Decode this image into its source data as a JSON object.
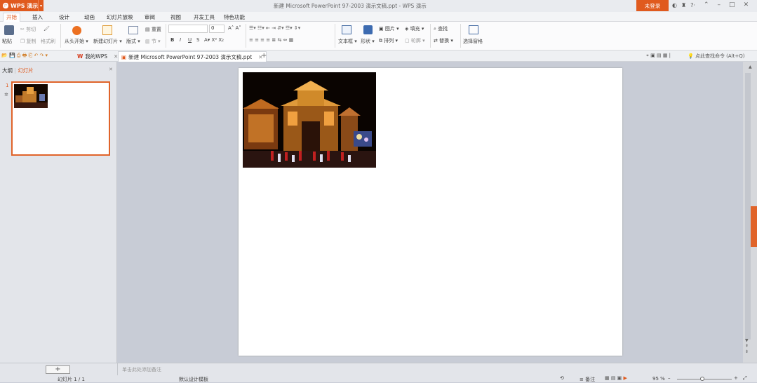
{
  "app": {
    "name": "WPS 演示",
    "title": "新建 Microsoft PowerPoint 97-2003 演示文稿.ppt - WPS 演示",
    "login_label": "未登录"
  },
  "menu_tabs": [
    "开始",
    "插入",
    "设计",
    "动画",
    "幻灯片放映",
    "审阅",
    "视图",
    "开发工具",
    "特色功能"
  ],
  "ribbon": {
    "paste": "粘贴",
    "cut": "剪切",
    "copy": "复制",
    "format_painter": "格式刷",
    "from_start": "从头开始",
    "new_slide": "新建幻灯片",
    "layout": "版式",
    "reset": "重置",
    "section": "节",
    "font_size": "0",
    "bold": "B",
    "italic": "I",
    "underline": "U",
    "strike": "S",
    "textbox": "文本框",
    "shape": "形状",
    "picture": "图片",
    "arrange": "排列",
    "fill": "填充",
    "outline": "轮廓",
    "find": "查找",
    "replace": "替换",
    "select_pane": "选择窗格"
  },
  "doc_tabs": {
    "home": "我的WPS",
    "doc": "新建 Microsoft PowerPoint 97-2003 演示文稿.ppt",
    "search_cmd": "点此查找命令 (Alt+Q)"
  },
  "left_pane": {
    "outline_tab": "大纲",
    "slides_tab": "幻灯片",
    "slide_number": "1"
  },
  "notes_placeholder": "单击此处添加备注",
  "status": {
    "slide_info": "幻灯片 1 / 1",
    "template": "默认设计模板",
    "notes": "备注",
    "zoom": "95 %"
  },
  "colors": {
    "accent": "#e05a1e"
  }
}
